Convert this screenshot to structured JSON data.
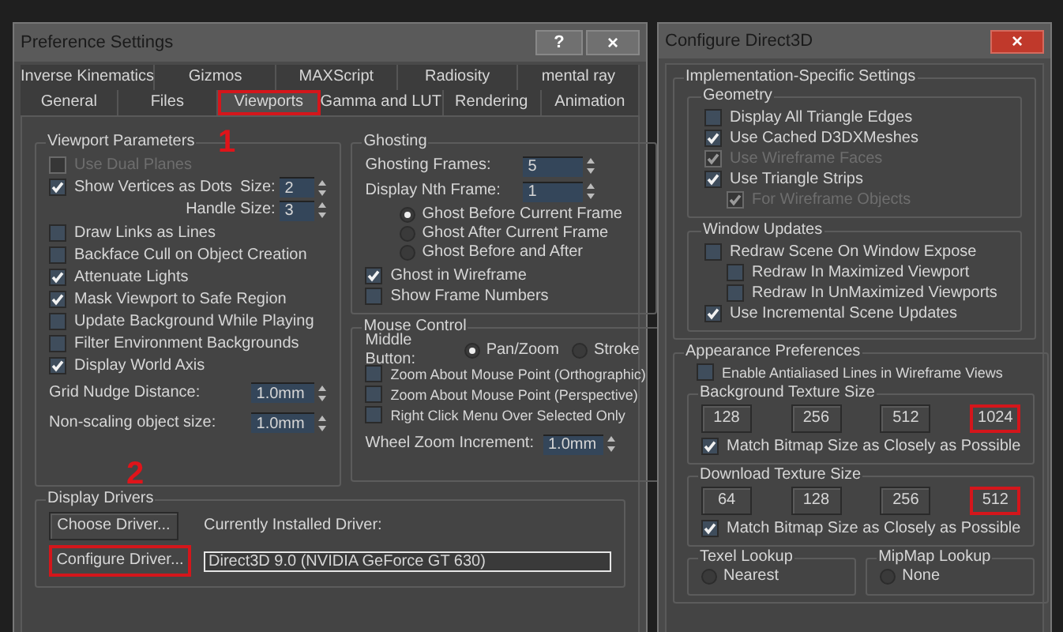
{
  "preference_dialog": {
    "title": "Preference Settings",
    "help_button": "?",
    "close_button": "×",
    "tab_rows": [
      [
        {
          "label": "Inverse Kinematics",
          "selected": false,
          "highlighted": false
        },
        {
          "label": "Gizmos",
          "selected": false,
          "highlighted": false
        },
        {
          "label": "MAXScript",
          "selected": false,
          "highlighted": false
        },
        {
          "label": "Radiosity",
          "selected": false,
          "highlighted": false
        },
        {
          "label": "mental ray",
          "selected": false,
          "highlighted": false
        }
      ],
      [
        {
          "label": "General",
          "selected": false,
          "highlighted": false
        },
        {
          "label": "Files",
          "selected": false,
          "highlighted": false
        },
        {
          "label": "Viewports",
          "selected": true,
          "highlighted": true
        },
        {
          "label": "Gamma and LUT",
          "selected": false,
          "highlighted": false
        },
        {
          "label": "Rendering",
          "selected": false,
          "highlighted": false
        },
        {
          "label": "Animation",
          "selected": false,
          "highlighted": false
        }
      ]
    ],
    "viewport_parameters": {
      "title": "Viewport Parameters",
      "items": [
        {
          "kind": "checkbox",
          "label": "Use Dual Planes",
          "checked": false,
          "disabled": true
        },
        {
          "kind": "checkbox",
          "label": "Show Vertices as Dots",
          "checked": true,
          "disabled": false,
          "spinner": {
            "label": "Size:",
            "value": "2"
          }
        },
        {
          "kind": "spinner_right",
          "label": "Handle Size:",
          "value": "3"
        },
        {
          "kind": "checkbox",
          "label": "Draw Links as Lines",
          "checked": false,
          "disabled": false
        },
        {
          "kind": "checkbox",
          "label": "Backface Cull on Object Creation",
          "checked": false,
          "disabled": false
        },
        {
          "kind": "checkbox",
          "label": "Attenuate Lights",
          "checked": true,
          "disabled": false
        },
        {
          "kind": "checkbox",
          "label": "Mask Viewport to Safe Region",
          "checked": true,
          "disabled": false
        },
        {
          "kind": "checkbox",
          "label": "Update Background While Playing",
          "checked": false,
          "disabled": false
        },
        {
          "kind": "checkbox",
          "label": "Filter Environment Backgrounds",
          "checked": false,
          "disabled": false
        },
        {
          "kind": "checkbox",
          "label": "Display World Axis",
          "checked": true,
          "disabled": false
        },
        {
          "kind": "spinner",
          "label": "Grid Nudge Distance:",
          "value": "1.0mm"
        },
        {
          "kind": "spinner",
          "label": "Non-scaling object size:",
          "value": "1.0mm"
        }
      ]
    },
    "ghosting": {
      "title": "Ghosting",
      "spinners": [
        {
          "label": "Ghosting Frames:",
          "value": "5"
        },
        {
          "label": "Display Nth Frame:",
          "value": "1"
        }
      ],
      "radios": [
        {
          "label": "Ghost Before Current Frame",
          "selected": true
        },
        {
          "label": "Ghost After Current Frame",
          "selected": false
        },
        {
          "label": "Ghost Before and After",
          "selected": false
        }
      ],
      "checkboxes": [
        {
          "label": "Ghost in Wireframe",
          "checked": true
        },
        {
          "label": "Show Frame Numbers",
          "checked": false
        }
      ]
    },
    "mouse_control": {
      "title": "Mouse Control",
      "middle_button_label": "Middle Button:",
      "middle_button_options": [
        {
          "label": "Pan/Zoom",
          "selected": true
        },
        {
          "label": "Stroke",
          "selected": false
        }
      ],
      "checkboxes": [
        {
          "label": "Zoom About Mouse Point (Orthographic)",
          "checked": false
        },
        {
          "label": "Zoom About Mouse Point (Perspective)",
          "checked": false
        },
        {
          "label": "Right Click Menu Over Selected Only",
          "checked": false
        }
      ],
      "wheel_zoom": {
        "label": "Wheel Zoom Increment:",
        "value": "1.0mm"
      }
    },
    "display_drivers": {
      "title": "Display Drivers",
      "buttons": [
        {
          "label": "Choose Driver...",
          "highlighted": false
        },
        {
          "label": "Configure Driver...",
          "highlighted": true
        }
      ],
      "current_label": "Currently Installed Driver:",
      "current_value": "Direct3D 9.0 (NVIDIA GeForce GT 630)"
    }
  },
  "annotations": [
    "1",
    "2"
  ],
  "direct3d_dialog": {
    "title": "Configure Direct3D",
    "close_button": "×",
    "implementation": {
      "title": "Implementation-Specific Settings",
      "groups": [
        {
          "title": "Geometry",
          "items": [
            {
              "label": "Display All Triangle Edges",
              "checked": false,
              "disabled": false
            },
            {
              "label": "Use Cached D3DXMeshes",
              "checked": true,
              "disabled": false
            },
            {
              "label": "Use Wireframe Faces",
              "checked": true,
              "disabled": true
            },
            {
              "label": "Use Triangle Strips",
              "checked": true,
              "disabled": false,
              "children": [
                {
                  "label": "For Wireframe Objects",
                  "checked": true,
                  "disabled": true
                }
              ]
            }
          ]
        },
        {
          "title": "Window Updates",
          "items": [
            {
              "label": "Redraw Scene On Window Expose",
              "checked": false,
              "disabled": false,
              "children": [
                {
                  "label": "Redraw In Maximized Viewport",
                  "checked": false,
                  "disabled": false
                },
                {
                  "label": "Redraw In UnMaximized Viewports",
                  "checked": false,
                  "disabled": false
                }
              ]
            },
            {
              "label": "Use Incremental Scene Updates",
              "checked": true,
              "disabled": false
            }
          ]
        }
      ]
    },
    "appearance": {
      "title": "Appearance Preferences",
      "antialias": {
        "label": "Enable Antialiased Lines in Wireframe Views",
        "checked": false
      },
      "texture_groups": [
        {
          "title": "Background Texture Size",
          "sizes": [
            {
              "label": "128",
              "highlighted": false
            },
            {
              "label": "256",
              "highlighted": false
            },
            {
              "label": "512",
              "highlighted": false
            },
            {
              "label": "1024",
              "highlighted": true
            }
          ],
          "match": {
            "label": "Match Bitmap Size as Closely as Possible",
            "checked": true
          }
        },
        {
          "title": "Download Texture Size",
          "sizes": [
            {
              "label": "64",
              "highlighted": false
            },
            {
              "label": "128",
              "highlighted": false
            },
            {
              "label": "256",
              "highlighted": false
            },
            {
              "label": "512",
              "highlighted": true
            }
          ],
          "match": {
            "label": "Match Bitmap Size as Closely as Possible",
            "checked": true
          }
        }
      ],
      "lookups": [
        {
          "title": "Texel Lookup",
          "option": {
            "label": "Nearest",
            "selected": false
          }
        },
        {
          "title": "MipMap Lookup",
          "option": {
            "label": "None",
            "selected": false
          }
        }
      ]
    }
  }
}
